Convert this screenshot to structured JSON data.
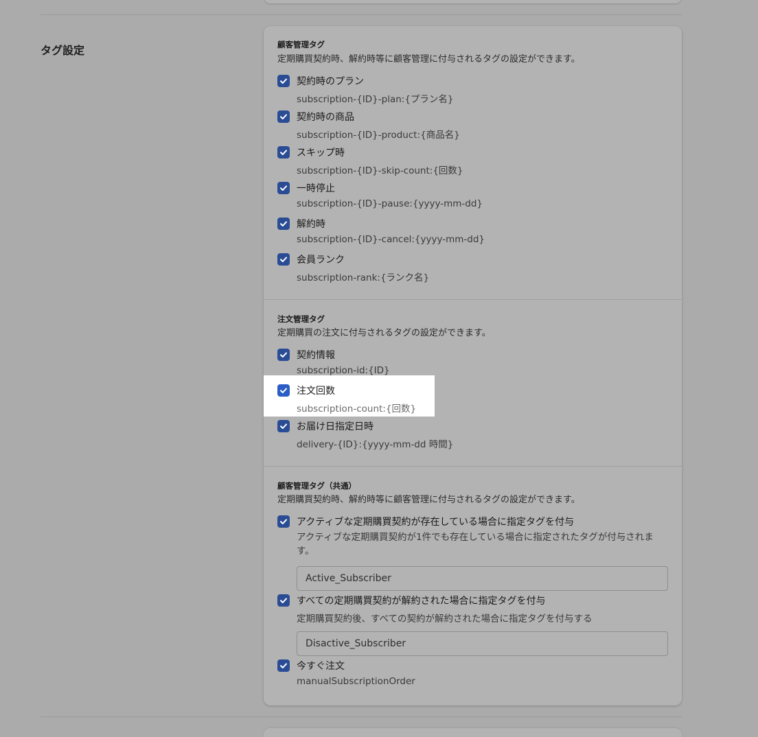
{
  "section": {
    "title": "タグ設定"
  },
  "customer_tags": {
    "title": "顧客管理タグ",
    "description": "定期購買契約時、解約時等に顧客管理に付与されるタグの設定ができます。",
    "options": [
      {
        "label": "契約時のプラン",
        "tag": "subscription-{ID}-plan:{プラン名}",
        "checked": true
      },
      {
        "label": "契約時の商品",
        "tag": "subscription-{ID}-product:{商品名}",
        "checked": true
      },
      {
        "label": "スキップ時",
        "tag": "subscription-{ID}-skip-count:{回数}",
        "checked": true
      },
      {
        "label": "一時停止",
        "tag": "subscription-{ID}-pause:{yyyy-mm-dd}",
        "checked": true
      },
      {
        "label": "解約時",
        "tag": "subscription-{ID}-cancel:{yyyy-mm-dd}",
        "checked": true
      },
      {
        "label": "会員ランク",
        "tag": "subscription-rank:{ランク名}",
        "checked": true
      }
    ]
  },
  "order_tags": {
    "title": "注文管理タグ",
    "description": "定期購買の注文に付与されるタグの設定ができます。",
    "options": [
      {
        "label": "契約情報",
        "tag": "subscription-id:{ID}",
        "checked": true
      },
      {
        "label": "注文回数",
        "tag": "subscription-count:{回数}",
        "checked": true
      },
      {
        "label": "お届け日指定日時",
        "tag": "delivery-{ID}:{yyyy-mm-dd 時間}",
        "checked": true
      }
    ]
  },
  "common_tags": {
    "title": "顧客管理タグ（共通）",
    "description": "定期購買契約時、解約時等に顧客管理に付与されるタグの設定ができます。",
    "active": {
      "label": "アクティブな定期購買契約が存在している場合に指定タグを付与",
      "help": "アクティブな定期購買契約が1件でも存在している場合に指定されたタグが付与されます。",
      "value": "Active_Subscriber",
      "checked": true
    },
    "inactive": {
      "label": "すべての定期購買契約が解約された場合に指定タグを付与",
      "help": "定期購買契約後、すべての契約が解約された場合に指定タグを付与する",
      "value": "Disactive_Subscriber",
      "checked": true
    },
    "manual": {
      "label": "今すぐ注文",
      "tag": "manualSubscriptionOrder",
      "checked": true
    }
  },
  "colors": {
    "overlay_bg": "#ababab",
    "checkbox": "#2a4c95",
    "checkbox_highlight": "#2c5cc5",
    "highlight_bg": "#ffffff"
  },
  "icons": {
    "checkbox": "checkmark-icon"
  }
}
